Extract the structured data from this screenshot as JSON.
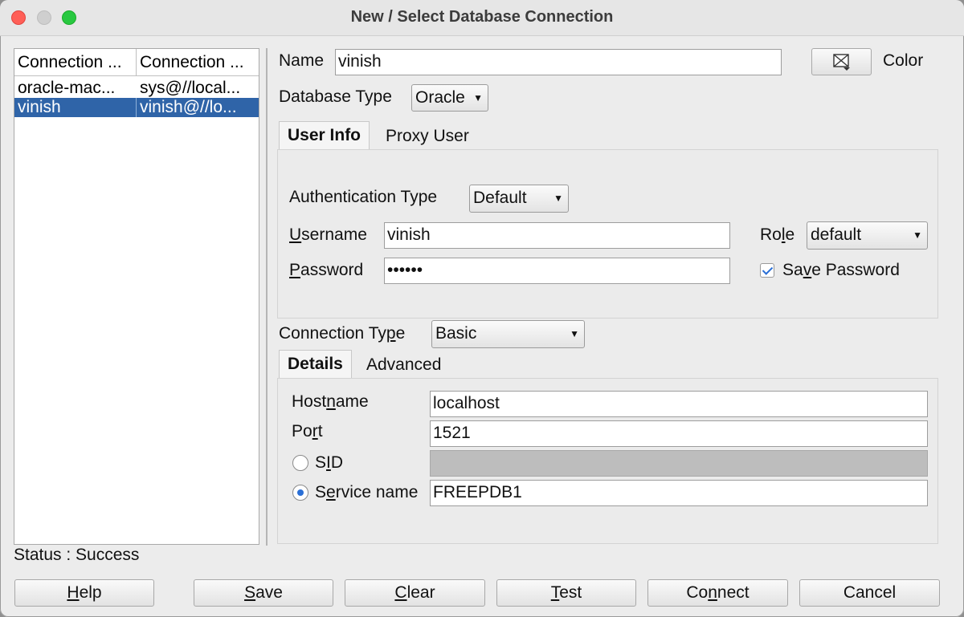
{
  "window": {
    "title": "New / Select Database Connection"
  },
  "connections": {
    "headers": [
      "Connection ...",
      "Connection ..."
    ],
    "rows": [
      {
        "name": "oracle-mac...",
        "details": "sys@//local...",
        "selected": false
      },
      {
        "name": "vinish",
        "details": "vinish@//lo...",
        "selected": true
      }
    ]
  },
  "form": {
    "name_label": "Name",
    "name_value": "vinish",
    "color_label": "Color",
    "color_icon": "color-swatch-icon",
    "db_type_label": "Database Type",
    "db_type_value": "Oracle",
    "tabs": [
      "User Info",
      "Proxy User"
    ],
    "auth_type_label": "Authentication Type",
    "auth_type_value": "Default",
    "username_label_u": "U",
    "username_label_rest": "sername",
    "username_value": "vinish",
    "password_label_p": "P",
    "password_label_rest": "assword",
    "password_value": "••••••",
    "role_label_a": "Ro",
    "role_label_u": "l",
    "role_label_b": "e",
    "role_value": "default",
    "save_password_a": "Sa",
    "save_password_u": "v",
    "save_password_b": "e Password",
    "save_password_checked": true,
    "connection_type_label_a": "Connection Ty",
    "connection_type_label_u": "p",
    "connection_type_label_b": "e",
    "connection_type_value": "Basic",
    "detail_tabs": [
      "Details",
      "Advanced"
    ],
    "hostname_label_a": "Host",
    "hostname_label_u": "n",
    "hostname_label_b": "ame",
    "hostname_value": "localhost",
    "port_label_a": "Po",
    "port_label_u": "r",
    "port_label_b": "t",
    "port_value": "1521",
    "sid_label_a": "S",
    "sid_label_u": "I",
    "sid_label_b": "D",
    "sid_value": "",
    "service_label_a": "S",
    "service_label_u": "e",
    "service_label_b": "rvice name",
    "service_value": "FREEPDB1",
    "service_selected": true
  },
  "status": {
    "text": "Status : Success"
  },
  "buttons": {
    "help_u": "H",
    "help_rest": "elp",
    "save_u": "S",
    "save_rest": "ave",
    "clear_u": "C",
    "clear_rest": "lear",
    "test_u": "T",
    "test_rest": "est",
    "connect_a": "Co",
    "connect_u": "n",
    "connect_b": "nect",
    "cancel": "Cancel"
  }
}
